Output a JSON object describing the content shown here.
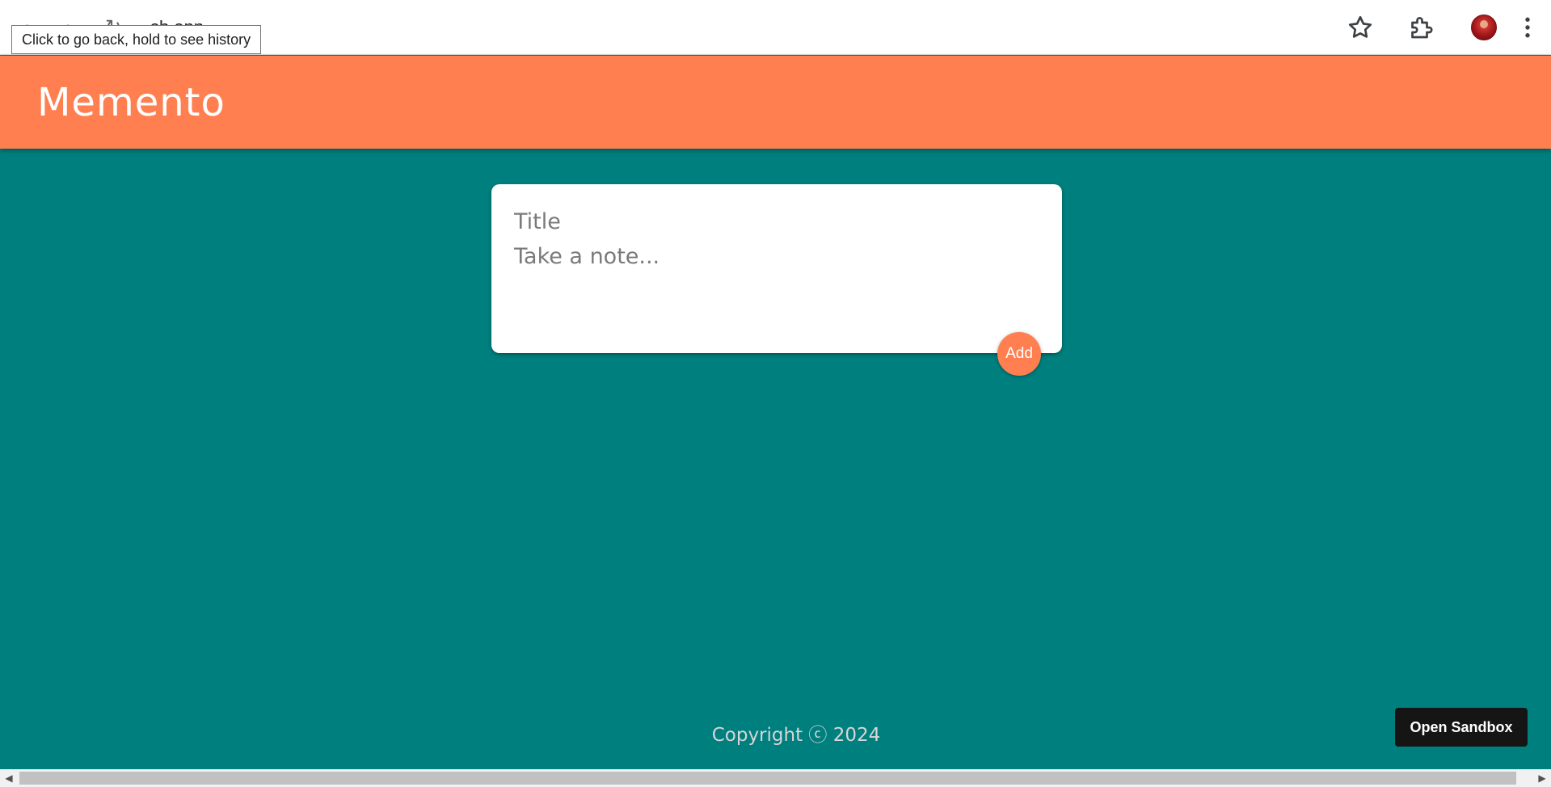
{
  "browser": {
    "url_fragment": "sb.app",
    "tooltip": "Click to go back, hold to see history",
    "icons": [
      "back-arrow-icon",
      "forward-arrow-icon",
      "reload-icon",
      "bookmark-star-icon",
      "extensions-puzzle-icon",
      "profile-avatar",
      "more-menu-icon"
    ]
  },
  "header": {
    "title": "Memento"
  },
  "note_form": {
    "title_placeholder": "Title",
    "body_placeholder": "Take a note...",
    "add_label": "Add"
  },
  "footer": {
    "copyright": "Copyright ⓒ 2024"
  },
  "sandbox_button": {
    "label": "Open Sandbox"
  },
  "colors": {
    "header_bg": "#ff7f50",
    "page_bg": "#008080",
    "card_bg": "#ffffff",
    "sandbox_bg": "#151515"
  }
}
